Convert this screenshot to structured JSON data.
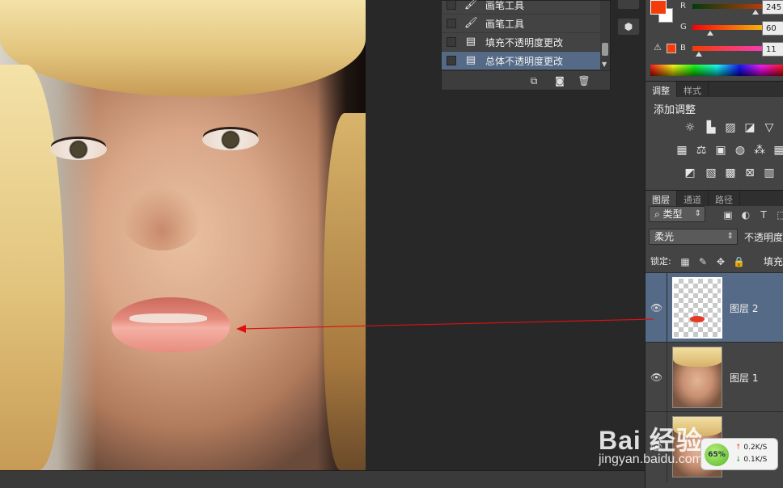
{
  "history": {
    "items": [
      {
        "label": "画笔工具",
        "icon": "brush-icon"
      },
      {
        "label": "画笔工具",
        "icon": "brush-icon"
      },
      {
        "label": "填充不透明度更改",
        "icon": "document-icon"
      },
      {
        "label": "总体不透明度更改",
        "icon": "document-icon",
        "active": true
      }
    ],
    "tools": [
      "new-document-from-state-icon",
      "camera-icon",
      "trash-icon"
    ]
  },
  "color": {
    "foreground": "#f53c0b",
    "background": "#ffffff",
    "r_label": "R",
    "r_value": "245",
    "g_label": "G",
    "g_value": "60",
    "b_label": "B",
    "b_value": "11"
  },
  "adjust_tabs": {
    "tab1": "调整",
    "tab2": "样式"
  },
  "adjust": {
    "title": "添加调整"
  },
  "layers_tabs": {
    "tab1": "图层",
    "tab2": "通道",
    "tab3": "路径"
  },
  "layers": {
    "filter_kind": "类型",
    "blend_mode": "柔光",
    "opacity_label": "不透明度",
    "lock_label": "锁定:",
    "fill_label": "填充",
    "items": [
      {
        "name": "图层 2",
        "selected": true
      },
      {
        "name": "图层 1",
        "selected": false
      },
      {
        "name": "",
        "selected": false
      }
    ]
  },
  "watermark": {
    "logo": "Bai 经验",
    "url": "jingyan.baidu.com"
  },
  "network": {
    "percent": "65%",
    "up": "0.2K/S",
    "down": "0.1K/S"
  }
}
